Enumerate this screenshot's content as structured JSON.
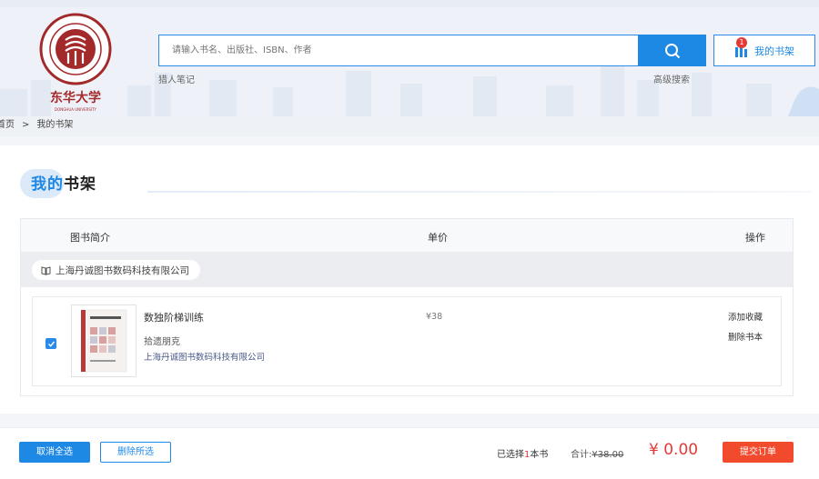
{
  "header": {
    "logo": {
      "name": "东华大学",
      "subtitle": "DONGHUA UNIVERSITY"
    },
    "search": {
      "placeholder": "请输入书名、出版社、ISBN、作者"
    },
    "shelf_button": {
      "label": "我的书架",
      "badge": "1"
    },
    "links": {
      "personal_notes": "猎人笔记",
      "advanced_search": "高级搜索"
    }
  },
  "breadcrumb": {
    "home": "首页",
    "sep": ">",
    "current": "我的书架"
  },
  "main": {
    "title_highlight": "我的",
    "title_rest": "书架",
    "table": {
      "headers": {
        "intro": "图书简介",
        "price": "单价",
        "ops": "操作"
      },
      "group": {
        "publisher": "上海丹诚图书数码科技有限公司"
      },
      "items": [
        {
          "title": "数独阶梯训练",
          "author": "拾遗朋克",
          "publisher": "上海丹诚图书数码科技有限公司",
          "price": "¥38",
          "op_favorite": "添加收藏",
          "op_delete": "删除书本",
          "checked": true
        }
      ]
    }
  },
  "footer": {
    "cancel_select": "取消全选",
    "delete_selected": "删除所选",
    "selected_prefix": "已选择",
    "selected_count": "1",
    "selected_suffix": "本书",
    "subtotal_label": "合计:",
    "subtotal_value": "¥38.00",
    "total": "¥ 0.00",
    "submit": "提交订单"
  },
  "colors": {
    "accent": "#1e88e5",
    "danger": "#e53935",
    "submit": "#f24a2d"
  }
}
